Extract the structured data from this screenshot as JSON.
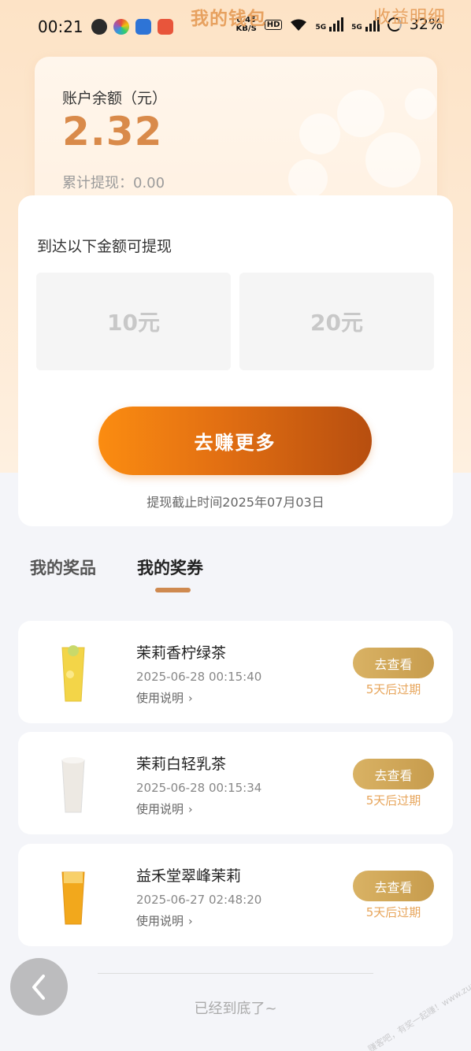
{
  "status_bar": {
    "time": "00:21",
    "net_speed_value": "0.45",
    "net_speed_unit": "KB/S",
    "hd_label": "HD",
    "signal_label": "5G",
    "battery": "32%"
  },
  "header": {
    "title": "我的钱包",
    "income_link": "收益明细"
  },
  "balance": {
    "label": "账户余额（元）",
    "value": "2.32",
    "withdrawn": "累计提现：0.00"
  },
  "withdraw": {
    "hint": "到达以下金额可提现",
    "options": [
      "10元",
      "20元"
    ],
    "earn_button": "去赚更多",
    "deadline": "提现截止时间2025年07月03日"
  },
  "tabs": {
    "prizes": "我的奖品",
    "coupons": "我的奖券",
    "active": "coupons"
  },
  "coupons": [
    {
      "name": "茉莉香柠绿茶",
      "time": "2025-06-28 00:15:40",
      "usage": "使用说明",
      "button": "去查看",
      "expire": "5天后过期",
      "drink_color": "#f3d548"
    },
    {
      "name": "茉莉白轻乳茶",
      "time": "2025-06-28 00:15:34",
      "usage": "使用说明",
      "button": "去查看",
      "expire": "5天后过期",
      "drink_color": "#ede9e3"
    },
    {
      "name": "益禾堂翠峰茉莉",
      "time": "2025-06-27 02:48:20",
      "usage": "使用说明",
      "button": "去查看",
      "expire": "5天后过期",
      "drink_color": "#f2a81c"
    }
  ],
  "footer": {
    "end_text": "已经到底了~"
  },
  "watermark": "赚客吧，有奖一起赚！www.zuanke8.com",
  "colors": {
    "accent": "#d98a4a",
    "button_orange": "#fb8c11",
    "button_gold": "#d9b264",
    "expire": "#e7a55b"
  }
}
